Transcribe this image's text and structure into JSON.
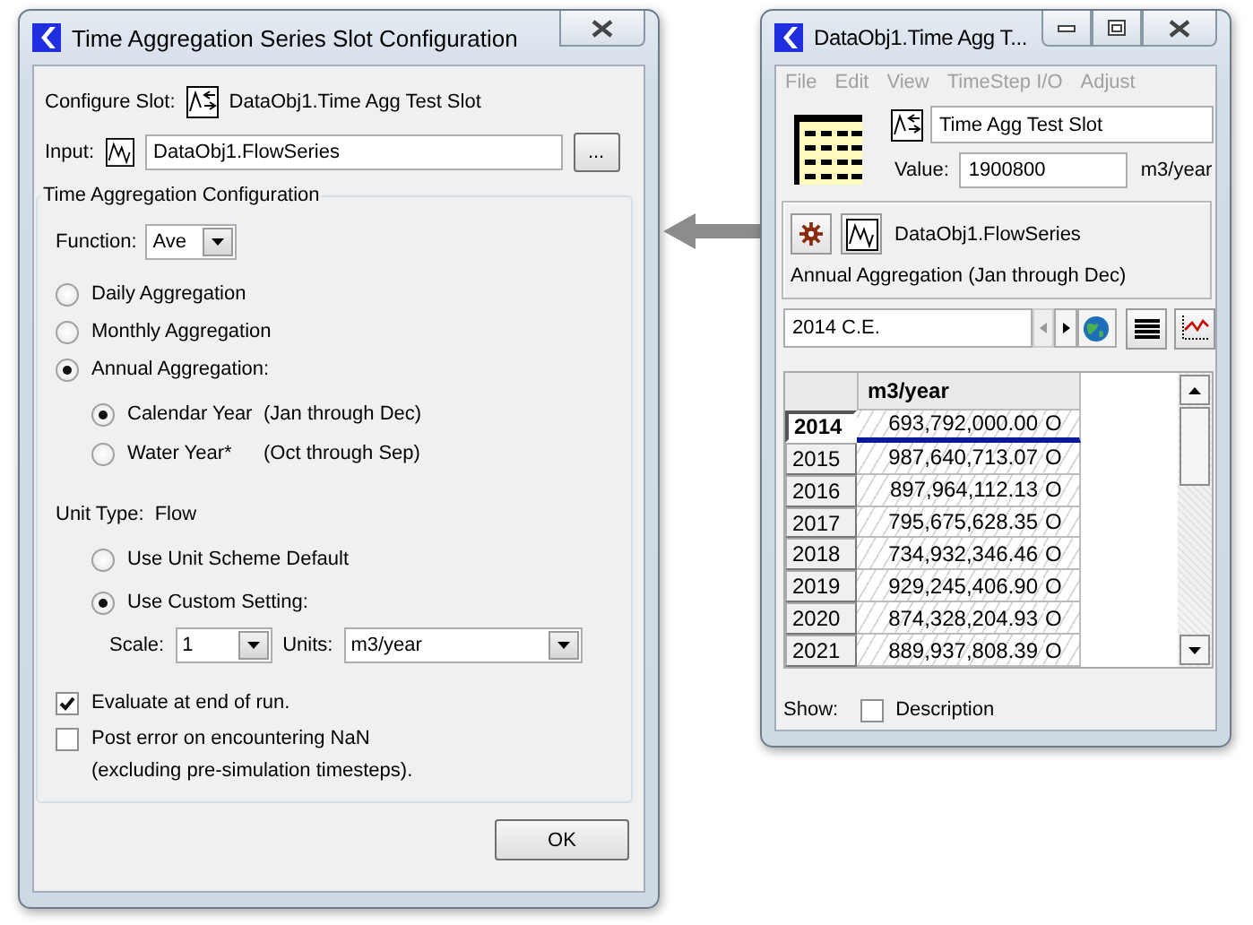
{
  "config_dialog": {
    "title": "Time Aggregation Series Slot Configuration",
    "configure_slot_label": "Configure Slot:",
    "configure_slot_value": "DataObj1.Time Agg Test Slot",
    "input_label": "Input:",
    "input_value": "DataObj1.FlowSeries",
    "browse_button": "...",
    "group_title": "Time Aggregation Configuration",
    "function_label": "Function:",
    "function_value": "Ave",
    "aggregation_options": [
      {
        "label": "Daily Aggregation",
        "selected": false
      },
      {
        "label": "Monthly Aggregation",
        "selected": false
      },
      {
        "label": "Annual Aggregation:",
        "selected": true
      }
    ],
    "year_options": [
      {
        "label": "Calendar Year",
        "note": "(Jan through Dec)",
        "selected": true
      },
      {
        "label": "Water Year*",
        "note": "(Oct through Sep)",
        "selected": false
      }
    ],
    "unit_type_label": "Unit Type:",
    "unit_type_value": "Flow",
    "unit_options": [
      {
        "label": "Use Unit Scheme Default",
        "selected": false
      },
      {
        "label": "Use Custom Setting:",
        "selected": true
      }
    ],
    "scale_label": "Scale:",
    "scale_value": "1",
    "units_label": "Units:",
    "units_value": "m3/year",
    "checkboxes": [
      {
        "label": "Evaluate at end of run.",
        "checked": true
      },
      {
        "label": "Post error on encountering NaN\n(excluding pre-simulation timesteps).",
        "checked": false
      }
    ],
    "ok_button": "OK"
  },
  "slot_window": {
    "title": "DataObj1.Time Agg T...",
    "menu": [
      {
        "label": "File",
        "disabled": true
      },
      {
        "label": "Edit",
        "disabled": true
      },
      {
        "label": "View",
        "disabled": true
      },
      {
        "label": "TimeStep I/O",
        "disabled": true
      },
      {
        "label": "Adjust",
        "disabled": true
      }
    ],
    "slot_name": "Time Agg Test Slot",
    "value_label": "Value:",
    "value": "1900800",
    "value_unit": "m3/year",
    "input_series": "DataObj1.FlowSeries",
    "aggregation_summary": "Annual Aggregation (Jan through Dec)",
    "date": "2014 C.E.",
    "table": {
      "column": "m3/year",
      "rows": [
        {
          "year": "2014",
          "value": "693,792,000.00",
          "flag": "O",
          "selected": true
        },
        {
          "year": "2015",
          "value": "987,640,713.07",
          "flag": "O",
          "selected": false
        },
        {
          "year": "2016",
          "value": "897,964,112.13",
          "flag": "O",
          "selected": false
        },
        {
          "year": "2017",
          "value": "795,675,628.35",
          "flag": "O",
          "selected": false
        },
        {
          "year": "2018",
          "value": "734,932,346.46",
          "flag": "O",
          "selected": false
        },
        {
          "year": "2019",
          "value": "929,245,406.90",
          "flag": "O",
          "selected": false
        },
        {
          "year": "2020",
          "value": "874,328,204.93",
          "flag": "O",
          "selected": false
        },
        {
          "year": "2021",
          "value": "889,937,808.39",
          "flag": "O",
          "selected": false
        }
      ]
    },
    "show_label": "Show:",
    "description_checkbox": {
      "label": "Description",
      "checked": false
    }
  }
}
